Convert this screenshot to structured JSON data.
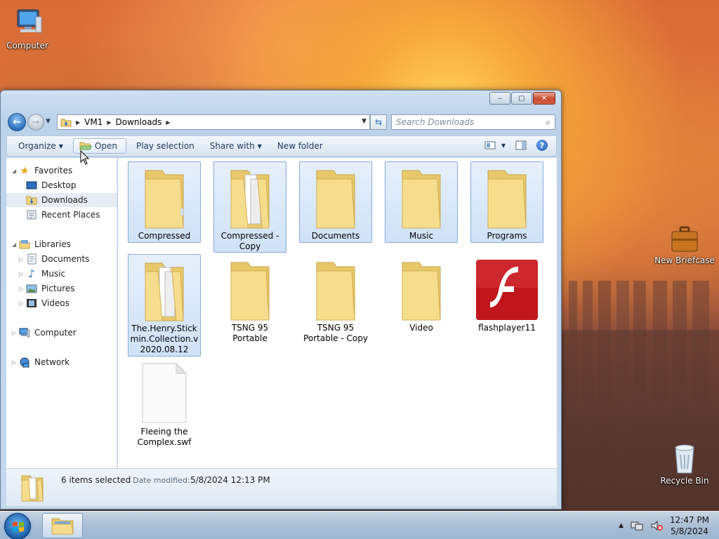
{
  "desktop": {
    "icons": [
      {
        "label": "Computer"
      },
      {
        "label": "New Briefcase"
      },
      {
        "label": "Recycle Bin"
      }
    ]
  },
  "window": {
    "address": {
      "crumbs": [
        "VM1",
        "Downloads"
      ]
    },
    "search": {
      "placeholder": "Search Downloads"
    },
    "toolbar": {
      "organize": "Organize",
      "open": "Open",
      "play_selection": "Play selection",
      "share_with": "Share with",
      "new_folder": "New folder"
    },
    "nav": {
      "favorites": "Favorites",
      "desktop": "Desktop",
      "downloads": "Downloads",
      "recent_places": "Recent Places",
      "libraries": "Libraries",
      "documents": "Documents",
      "music": "Music",
      "pictures": "Pictures",
      "videos": "Videos",
      "computer": "Computer",
      "network": "Network"
    },
    "items": [
      {
        "label": "Compressed",
        "selected": true,
        "kind": "folder"
      },
      {
        "label": "Compressed - Copy",
        "selected": true,
        "kind": "folder-files"
      },
      {
        "label": "Documents",
        "selected": true,
        "kind": "folder"
      },
      {
        "label": "Music",
        "selected": true,
        "kind": "folder"
      },
      {
        "label": "Programs",
        "selected": true,
        "kind": "folder"
      },
      {
        "label": "The.Henry.Stickmin.Collection.v2020.08.12",
        "selected": true,
        "kind": "folder-files"
      },
      {
        "label": "TSNG 95 Portable",
        "selected": false,
        "kind": "folder"
      },
      {
        "label": "TSNG 95 Portable - Copy",
        "selected": false,
        "kind": "folder"
      },
      {
        "label": "Video",
        "selected": false,
        "kind": "folder"
      },
      {
        "label": "flashplayer11",
        "selected": false,
        "kind": "flash"
      },
      {
        "label": "Fleeing the Complex.swf",
        "selected": false,
        "kind": "file"
      }
    ],
    "details": {
      "count": "6 items selected",
      "date_label": "Date modified:",
      "date_value": "5/8/2024 12:13 PM"
    }
  },
  "taskbar": {
    "time": "12:47 PM",
    "date": "5/8/2024"
  },
  "colors": {
    "folder": "#f2d57e",
    "selection": "#cfe2f7",
    "flash_red": "#c0161b"
  }
}
